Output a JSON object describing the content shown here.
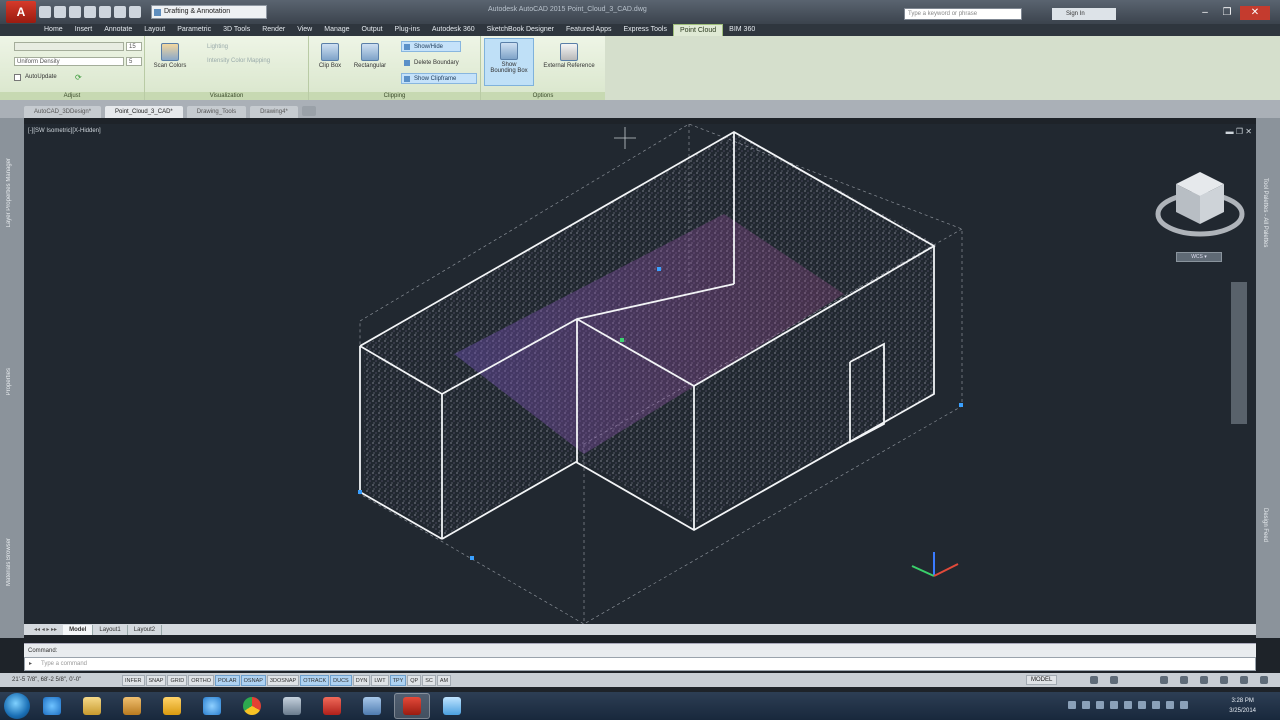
{
  "titlebar": {
    "app_letter": "A",
    "workspace": "Drafting & Annotation",
    "doc_title": "Autodesk AutoCAD 2015   Point_Cloud_3_CAD.dwg",
    "search_placeholder": "Type a keyword or phrase",
    "user": "Sign In"
  },
  "ribbon_tabs": [
    "Home",
    "Insert",
    "Annotate",
    "Layout",
    "Parametric",
    "3D Tools",
    "Render",
    "View",
    "Manage",
    "Output",
    "Plug-ins",
    "Autodesk 360",
    "SketchBook Designer",
    "Featured Apps",
    "Express Tools",
    "Point Cloud",
    "BIM 360"
  ],
  "ribbon_active_tab": "Point Cloud",
  "ribbon": {
    "adjust": {
      "title": "Adjust",
      "density_value": "15",
      "uniform_density": "Uniform Density",
      "uniform_value": "5",
      "autoupdate": "AutoUpdate"
    },
    "visualization": {
      "title": "Visualization",
      "scan_colors": "Scan Colors",
      "lighting": "Lighting",
      "intensity": "Intensity Color Mapping"
    },
    "clipping": {
      "title": "Clipping",
      "clip_box": "Clip Box",
      "rectangular": "Rectangular",
      "show_hide": "Show/Hide",
      "delete_boundary": "Delete Boundary",
      "show_clipframe": "Show Clipframe"
    },
    "options": {
      "title": "Options",
      "show_bbox_1": "Show",
      "show_bbox_2": "Bounding Box",
      "external_reference": "External Reference"
    }
  },
  "file_tabs": [
    "AutoCAD_3DDesign*",
    "Point_Cloud_3_CAD*",
    "Drawing_Tools",
    "Drawing4*"
  ],
  "file_tab_active": 1,
  "left_palette": [
    "Layer Properties Manager",
    "Properties",
    "Materials Browser"
  ],
  "right_palette": [
    "Tool Palettes - All Palettes",
    "Design Feed"
  ],
  "viewport": {
    "label": "[-][SW Isometric][X-Hidden]",
    "controls": "▬ ❐ ✕",
    "wcs": "WCS ▾"
  },
  "layout_tabs": [
    "Model",
    "Layout1",
    "Layout2"
  ],
  "command": {
    "history": "Command:",
    "placeholder": "Type a command"
  },
  "status": {
    "coords": "21'-5 7/8\", 68'-2 5/8\", 0'-0\"",
    "toggles": [
      "INFER",
      "SNAP",
      "GRID",
      "ORTHO",
      "POLAR",
      "OSNAP",
      "3DOSNAP",
      "OTRACK",
      "DUCS",
      "DYN",
      "LWT",
      "TPY",
      "QP",
      "SC",
      "AM"
    ],
    "on": [
      "POLAR",
      "OSNAP",
      "OTRACK",
      "DUCS",
      "TPY"
    ],
    "model": "MODEL"
  },
  "taskbar": {
    "time": "3:28 PM",
    "date": "3/25/2014"
  },
  "colors": {
    "accent_green": "#dfe9d4",
    "viewport_bg": "#212830",
    "autocad_red": "#c0281a"
  }
}
